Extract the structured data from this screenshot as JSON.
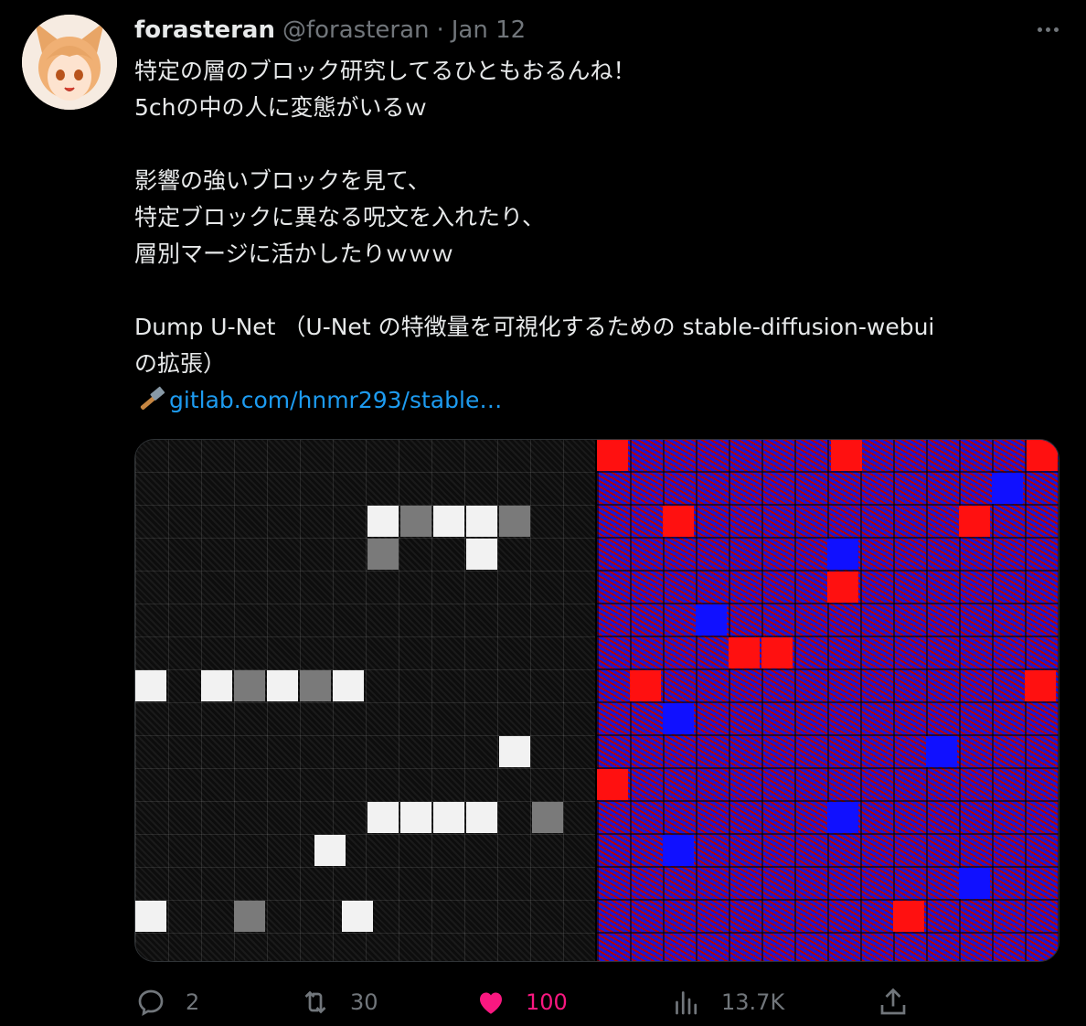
{
  "tweet": {
    "display_name": "forasteran",
    "handle": "@forasteran",
    "separator": "·",
    "date": "Jan 12",
    "lines": [
      "特定の層のブロック研究してるひともおるんね！",
      "5chの中の人に変態がいるｗ",
      "",
      "影響の強いブロックを見て、",
      "特定ブロックに異なる呪文を入れたり、",
      "層別マージに活かしたりｗｗｗ",
      "",
      "Dump U-Net （U-Net の特徴量を可視化するための stable-diffusion-webui",
      "の拡張）"
    ],
    "link_text": "gitlab.com/hnmr293/stable…"
  },
  "actions": {
    "replies": "2",
    "retweets": "30",
    "likes": "100",
    "views": "13.7K"
  },
  "colors": {
    "background": "#000000",
    "text": "#e7e9ea",
    "muted": "#71767b",
    "link": "#1d9bf0",
    "like": "#f91880"
  },
  "icons": [
    "more-icon",
    "hammer-icon",
    "reply-icon",
    "retweet-icon",
    "heart-icon",
    "views-icon",
    "share-icon"
  ]
}
